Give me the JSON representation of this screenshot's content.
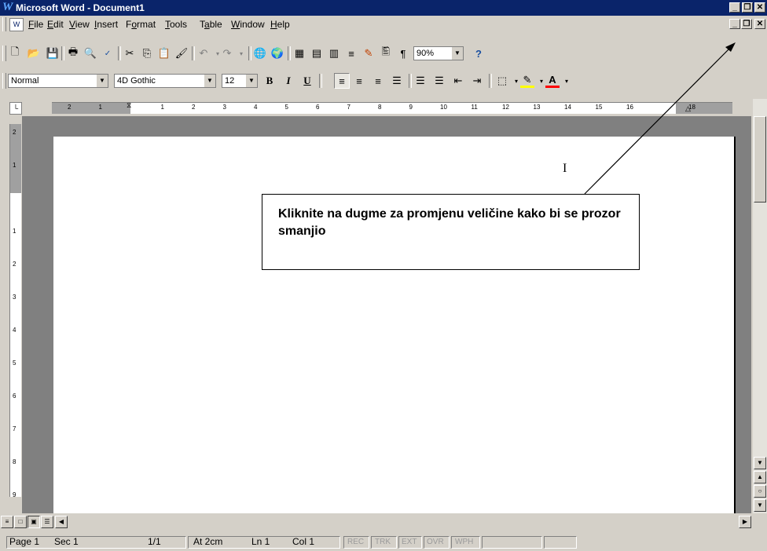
{
  "window": {
    "title": "Microsoft Word - Document1"
  },
  "menu": {
    "items": [
      {
        "label": "File",
        "key": "F"
      },
      {
        "label": "Edit",
        "key": "E"
      },
      {
        "label": "View",
        "key": "V"
      },
      {
        "label": "Insert",
        "key": "I"
      },
      {
        "label": "Format",
        "key": "o"
      },
      {
        "label": "Tools",
        "key": "T"
      },
      {
        "label": "Table",
        "key": "a"
      },
      {
        "label": "Window",
        "key": "W"
      },
      {
        "label": "Help",
        "key": "H"
      }
    ]
  },
  "standard_toolbar": {
    "zoom": "90%"
  },
  "formatting_toolbar": {
    "style": "Normal",
    "font": "4D Gothic",
    "size": "12",
    "bold": "B",
    "italic": "I",
    "underline": "U"
  },
  "ruler": {
    "h_labels": [
      "2",
      "1",
      "",
      "1",
      "2",
      "3",
      "4",
      "5",
      "6",
      "7",
      "8",
      "9",
      "10",
      "11",
      "12",
      "13",
      "14",
      "15",
      "16",
      "",
      "18"
    ],
    "v_labels": [
      "2",
      "1",
      "",
      "1",
      "2",
      "3",
      "4",
      "5",
      "6",
      "7",
      "8",
      "9"
    ]
  },
  "callout": {
    "text": "Kliknite na dugme za promjenu veličine kako bi se prozor smanjio"
  },
  "status": {
    "page": "Page 1",
    "sec": "Sec 1",
    "pages": "1/1",
    "at": "At 2cm",
    "ln": "Ln 1",
    "col": "Col 1",
    "rec": "REC",
    "trk": "TRK",
    "ext": "EXT",
    "ovr": "OVR",
    "wph": "WPH"
  },
  "colors": {
    "titlebar": "#0a246a",
    "face": "#d4d0c8",
    "page": "#ffffff"
  }
}
